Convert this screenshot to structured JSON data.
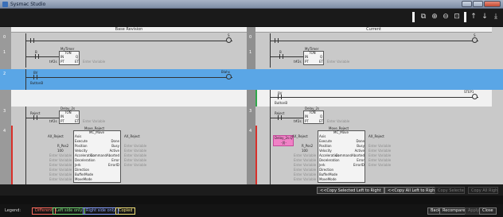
{
  "window": {
    "title": "Sysmac Studio"
  },
  "toolbar": {
    "icons": [
      "copy-icon",
      "zoom-in-icon",
      "zoom-out-icon",
      "zoom-fit-icon",
      "arrow-up-icon",
      "arrow-down-icon",
      "export-icon"
    ]
  },
  "panes": {
    "left_title": "Base Revision",
    "right_title": "Current"
  },
  "rows": [
    "0",
    "1",
    "2",
    "3",
    "4"
  ],
  "left": {
    "r0_coil": "S",
    "r1_fb_name": "MyTimer",
    "r1_fb_type": "TON",
    "r1_in": "IN",
    "r1_q": "Q",
    "r1_pt": "PT",
    "r1_et": "ET",
    "r1_const": "t#2s",
    "r1_enter": "Enter Variable",
    "r1_contact": "B",
    "r2_contact": "BV",
    "r2_contact2": "ButtonB",
    "r2_coil": "Blahs",
    "r3_contact": "Reject",
    "r3_fb_name": "Delay_2s",
    "r3_fb_type": "TON",
    "r3_in": "IN",
    "r3_q": "Q",
    "r3_pt": "PT",
    "r3_et": "ET",
    "r3_const": "t#2s",
    "r3_enter": "Enter Variable",
    "r4_inst": "Move_Reject",
    "r4_type": "MC_Move",
    "r4_axis_var": "AX_Reject",
    "r4_axis": "Axis",
    "r4_axis_out": "AX_Reject",
    "r4_ins": [
      "Execute",
      "Position",
      "Velocity",
      "Acceleration",
      "Deceleration",
      "Jerk",
      "Direction",
      "BufferMode",
      "MoveMode"
    ],
    "r4_in_vals": [
      "",
      "R_Pos2",
      "100",
      "Enter Variable",
      "Enter Variable",
      "Enter Variable",
      "Enter Variable",
      "Enter Variable",
      "Enter Variable"
    ],
    "r4_outs": [
      "Done",
      "Busy",
      "Active",
      "CommandAborted",
      "Error",
      "ErrorID"
    ],
    "r4_out_vals": [
      "",
      "Enter Variable",
      "Enter Variable",
      "Enter Variable",
      "Enter Variable",
      "Enter Variable"
    ]
  },
  "right": {
    "r0_coil": "S",
    "r1_fb_name": "MyTimer",
    "r1_fb_type": "TON",
    "r1_in": "IN",
    "r1_q": "Q",
    "r1_pt": "PT",
    "r1_et": "ET",
    "r1_const": "t#2s",
    "r1_enter": "Enter Variable",
    "r1_contact": "B",
    "r2_contact": "BV",
    "r2_contact2": "ButtonB",
    "r2_coil": "STEP1",
    "r3_contact": "Reject",
    "r3_fb_name": "Delay_2s",
    "r3_fb_type": "TON",
    "r3_in": "IN",
    "r3_q": "Q",
    "r3_pt": "PT",
    "r3_et": "ET",
    "r3_const": "t#2s",
    "r3_enter": "Enter Variable",
    "r4_inst": "Move_Reject",
    "r4_type": "MC_Move",
    "r4_axis_var": "AX_Reject",
    "r4_axis": "Axis",
    "r4_axis_out": "AX_Reject",
    "r4_pink": "Delay_2s.Q",
    "r4_ins": [
      "Execute",
      "Position",
      "Velocity",
      "Acceleration",
      "Deceleration",
      "Jerk",
      "Direction",
      "BufferMode",
      "MoveMode"
    ],
    "r4_in_vals": [
      "",
      "R_Pos2",
      "100",
      "Enter Variable",
      "Enter Variable",
      "Enter Variable",
      "Enter Variable",
      "Enter Variable",
      "Enter Variable"
    ],
    "r4_outs": [
      "Done",
      "Busy",
      "Active",
      "CommandAborted",
      "Error",
      "ErrorID"
    ],
    "r4_out_vals": [
      "",
      "Enter Variable",
      "Enter Variable",
      "Enter Variable",
      "Enter Variable",
      "Enter Variable"
    ]
  },
  "copy_buttons": {
    "selected_ltr": "<<Copy Selected Left to Right",
    "all_ltr": "<<Copy All Left to Right",
    "selected_rtl": "Copy Selected Right to Left",
    "all_rtl": "Copy All Right to Left"
  },
  "legend": {
    "label": "Legend:",
    "different": "Different",
    "left_only": "Left side only",
    "right_only": "Right side only",
    "copied": "Copied"
  },
  "actions": {
    "back": "Back",
    "recompare": "Recompare",
    "apply": "Apply",
    "close": "Close"
  },
  "colors": {
    "blue_row": "#5aa6e6",
    "diff_red": "#d9302a",
    "changed_green": "#2fa84a",
    "pink": "#f081c6"
  }
}
